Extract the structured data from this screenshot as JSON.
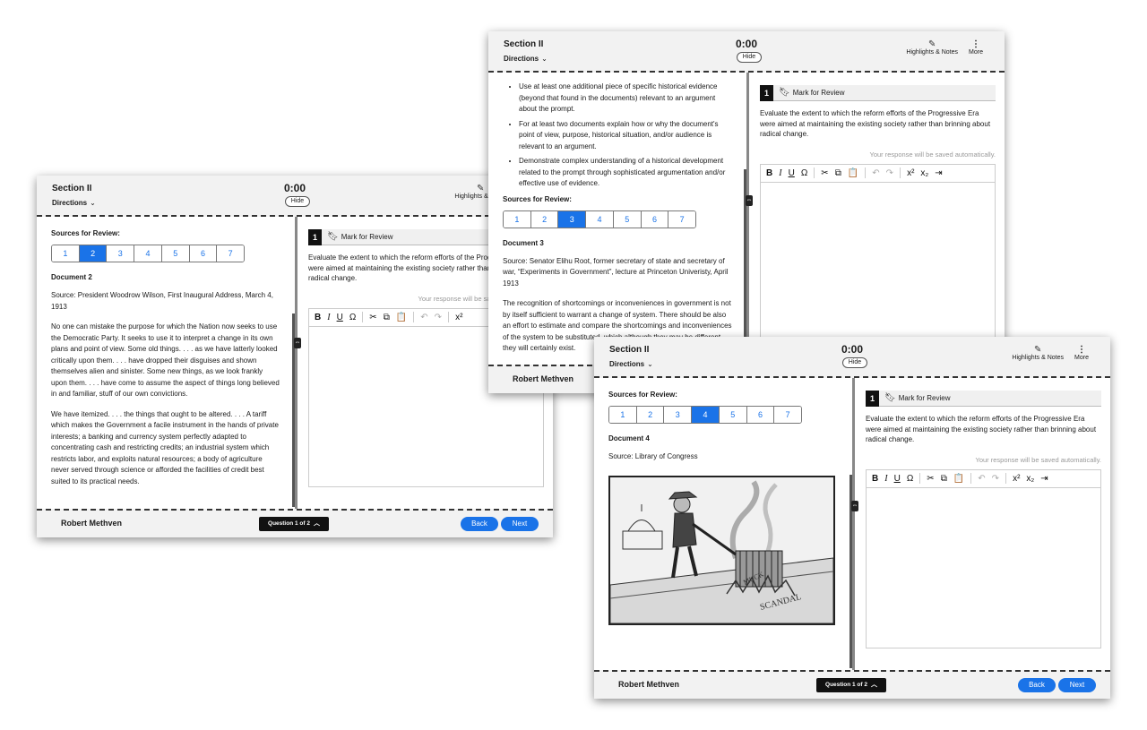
{
  "common": {
    "section_title": "Section II",
    "directions_label": "Directions",
    "timer": "0:00",
    "hide_label": "Hide",
    "highlights_label": "Highlights & Notes",
    "more_label": "More",
    "sources_label": "Sources for Review:",
    "source_tabs": [
      "1",
      "2",
      "3",
      "4",
      "5",
      "6",
      "7"
    ],
    "question_number": "1",
    "mark_for_review": "Mark for Review",
    "prompt": "Evaluate the extent to which the reform efforts of the Progressive Era were aimed at maintaining the existing society rather than brinning about radical change.",
    "saved_notice": "Your response will be saved automatically.",
    "student_name": "Robert Methven",
    "question_pill": "Question 1 of 2",
    "back_label": "Back",
    "next_label": "Next",
    "toolbar": [
      "B",
      "I",
      "U",
      "Ω",
      "✂",
      "⧉",
      "📋",
      "↶",
      "↷",
      "x²",
      "x₂",
      "⇥"
    ]
  },
  "win_a": {
    "active_tab": "2",
    "doc_title": "Document 2",
    "source": "Source: President Woodrow Wilson, First Inaugural Address, March 4, 1913",
    "para1": "No one can mistake the purpose for which the Nation now seeks to use the Democratic Party. It seeks to use it to interpret a change in its own plans and point of view. Some old things. . . . as we have latterly looked critically upon them. . . . have dropped their disguises and shown themselves alien and sinister. Some new things, as we look frankly upon them. . . . have come to assume the aspect of things long believed in and familiar, stuff of our own convictions.",
    "para2": "We have itemized. . . . the things that ought to be altered. . . . A tariff which makes the Government a facile instrument in the hands of private interests; a banking and currency system perfectly adapted to concentrating cash and restricting credits; an industrial system which restricts labor, and exploits natural resources; a body of agriculture never served through science or afforded the facilities of credit best suited to its practical needs."
  },
  "win_b": {
    "active_tab": "3",
    "bullets": [
      "Use at least one additional piece of specific historical evidence (beyond that found in the documents) relevant to an argument about the prompt.",
      "For at least two documents explain how or why the document's point of view, purpose, historical situation, and/or audience is relevant to an argument.",
      "Demonstrate complex understanding of a historical development related to the prompt through sophisticated argumentation and/or effective use of evidence."
    ],
    "doc_title": "Document 3",
    "source": "Source: Senator Elihu Root, former secretary of state and secretary of war, “Experiments in Government”, lecture at Princeton Univeristy, April 1913",
    "para1": "The recognition of shortcomings or inconveniences in government is not by itself sufficient to warrant a change of system. There should be also an effort to estimate and compare the shortcomings and inconveniences of the system to be substituted, which although they may be different, they will certainly exist."
  },
  "win_c": {
    "active_tab": "4",
    "doc_title": "Document 4",
    "source": "Source: Library of Congress"
  }
}
